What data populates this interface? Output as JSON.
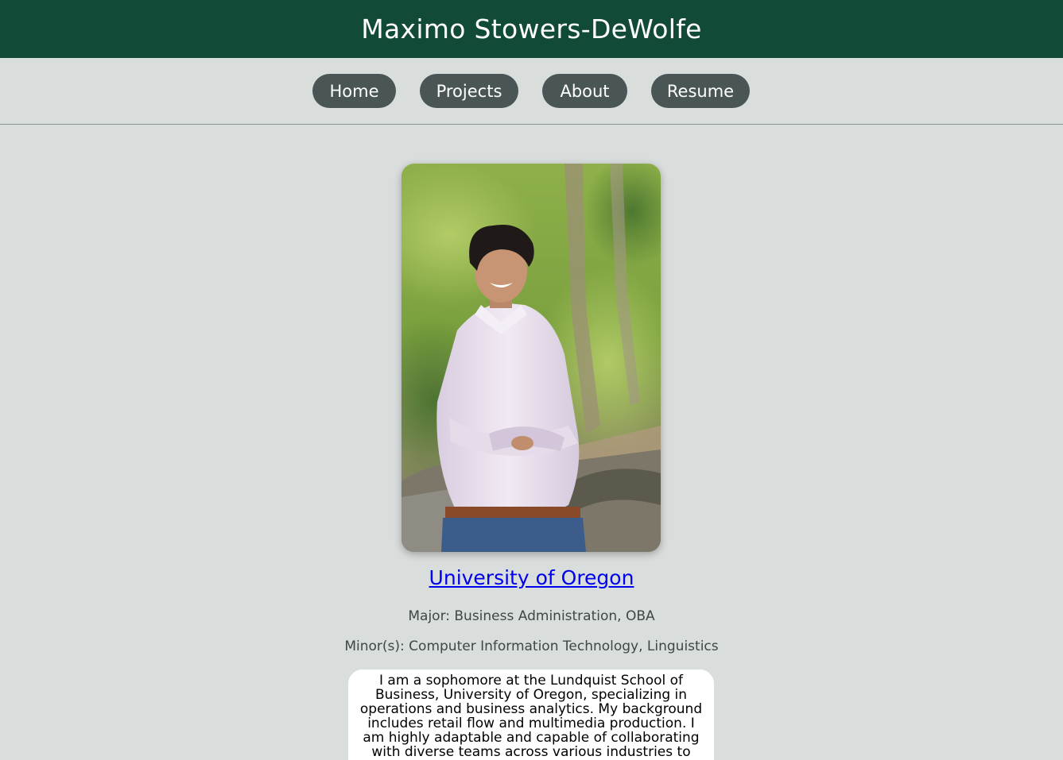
{
  "header": {
    "title": "Maximo Stowers-DeWolfe"
  },
  "nav": {
    "items": [
      {
        "label": "Home"
      },
      {
        "label": "Projects"
      },
      {
        "label": "About"
      },
      {
        "label": "Resume"
      }
    ]
  },
  "colors": {
    "header_bg": "#124a38",
    "page_bg": "#d9dddc",
    "nav_button_bg": "#4a5656",
    "link": "#0000ee"
  },
  "profile": {
    "university_link": "University of Oregon",
    "major": "Major: Business Administration, OBA",
    "minors": "Minor(s): Computer Information Technology, Linguistics",
    "bio": "I am a sophomore at the Lundquist School of Business, University of Oregon, specializing in operations and business analytics. My background includes retail flow and multimedia production. I am highly adaptable and capable of collaborating with diverse teams across various industries to achieve outstanding outcomes. My"
  }
}
